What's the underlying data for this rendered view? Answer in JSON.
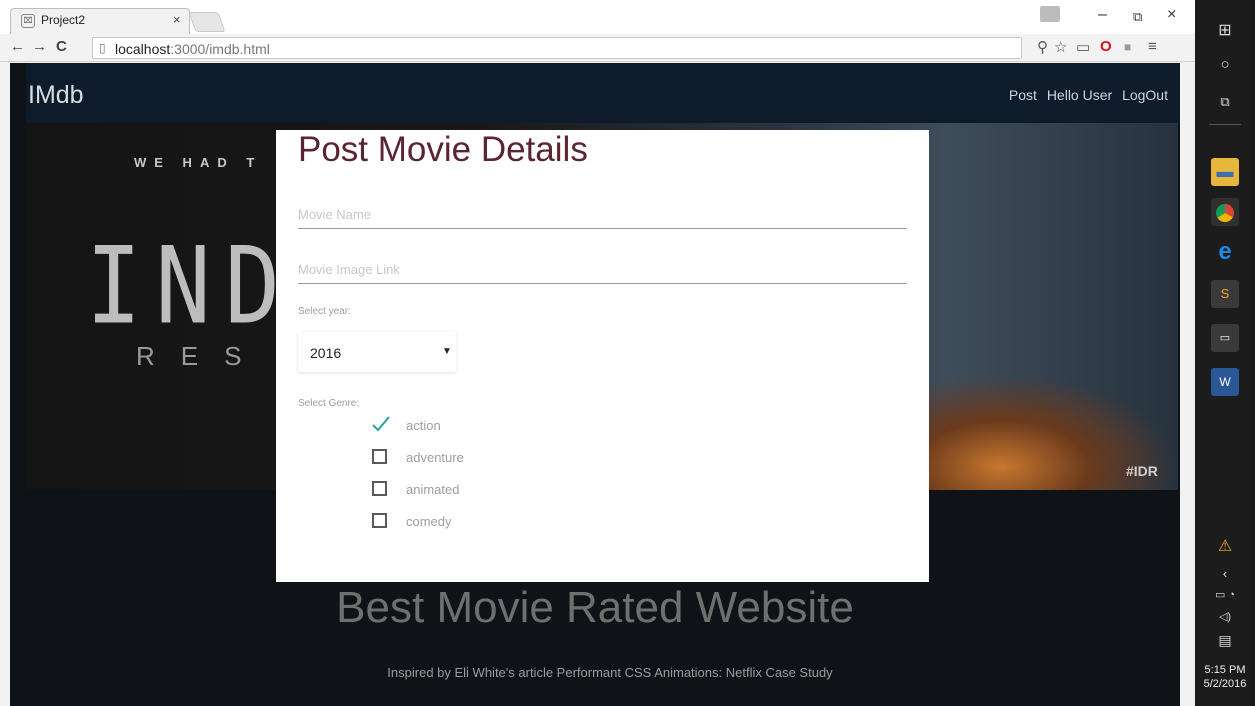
{
  "browser": {
    "tab_title": "Project2",
    "tab_favicon": "⌧",
    "tab_close": "×",
    "url_host": "localhost",
    "url_path": ":3000/imdb.html",
    "minimize": "–",
    "restore": "⧉",
    "close": "×"
  },
  "nav": {
    "brand": "IMdb",
    "links": [
      "Post",
      "Hello User",
      "LogOut"
    ]
  },
  "hero": {
    "tagline": "WE HAD T",
    "big_text": "INDEP",
    "sub_text": "RES",
    "hashtag": "#IDR"
  },
  "modal": {
    "title": "Post Movie Details",
    "movie_name_placeholder": "Movie Name",
    "movie_image_placeholder": "Movie Image Link",
    "year_label": "Select year:",
    "year_value": "2016",
    "genre_label": "Select Genre:",
    "genres": [
      {
        "label": "action",
        "checked": true
      },
      {
        "label": "adventure",
        "checked": false
      },
      {
        "label": "animated",
        "checked": false
      },
      {
        "label": "comedy",
        "checked": false
      }
    ]
  },
  "footer": {
    "title": "Best Movie Rated Website",
    "text": "Inspired by Eli White's article Performant CSS Animations: Netflix Case Study"
  },
  "taskbar": {
    "time": "5:15 PM",
    "date": "5/2/2016"
  },
  "colors": {
    "modal_title": "#5a2430",
    "checkmark": "#26a69a",
    "navbar": "#0d1b2a"
  }
}
